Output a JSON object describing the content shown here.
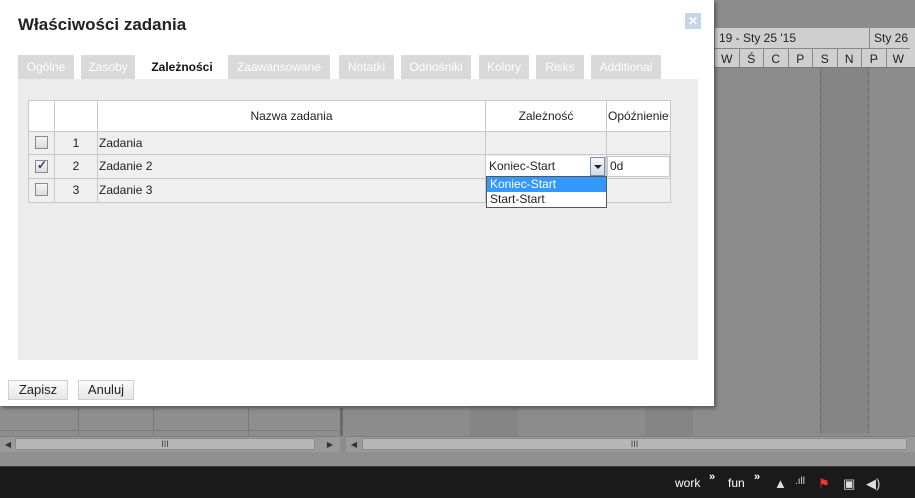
{
  "dialog": {
    "title": "Właściwości zadania",
    "close_glyph": "✕",
    "tabs": [
      {
        "label": "Ogólne",
        "active": false
      },
      {
        "label": "Zasoby",
        "active": false
      },
      {
        "label": "Zależności",
        "active": true
      },
      {
        "label": "Zaawansowane",
        "active": false
      },
      {
        "label": "Notatki",
        "active": false
      },
      {
        "label": "Odnośniki",
        "active": false
      },
      {
        "label": "Kolory",
        "active": false
      },
      {
        "label": "Risks",
        "active": false
      },
      {
        "label": "Additional",
        "active": false
      }
    ],
    "table": {
      "columns": [
        "",
        "",
        "Nazwa zadania",
        "Zależność",
        "Opóźnienie"
      ],
      "rows": [
        {
          "checked": false,
          "num": "1",
          "name": "Zadania",
          "dependency": "",
          "delay": ""
        },
        {
          "checked": true,
          "num": "2",
          "name": "Zadanie 2",
          "dependency": "Koniec-Start",
          "delay": "0d"
        },
        {
          "checked": false,
          "num": "3",
          "name": "Zadanie 3",
          "dependency": "",
          "delay": ""
        }
      ]
    },
    "dependency_options": [
      "Koniec-Start",
      "Start-Start"
    ],
    "buttons": {
      "save": "Zapisz",
      "cancel": "Anuluj"
    }
  },
  "gantt": {
    "weeks": [
      "19 - Sty 25 '15",
      "Sty 26 -"
    ],
    "days": [
      "W",
      "Ś",
      "C",
      "P",
      "S",
      "N",
      "P",
      "W"
    ]
  },
  "scroll_glyph": "III",
  "taskbar": {
    "items": [
      "work",
      "fun"
    ],
    "chevron": "»"
  }
}
